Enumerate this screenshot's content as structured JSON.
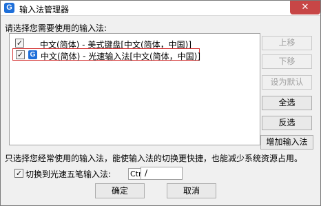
{
  "window": {
    "title": "输入法管理器",
    "app_icon_glyph": "G",
    "close_glyph": "✕"
  },
  "list": {
    "label": "请选择您需要使用的输入法:",
    "items": [
      {
        "label": "中文(简体) - 美式键盘[中文(简体，中国)]",
        "checked": true,
        "has_icon": false
      },
      {
        "label": "中文(简体) - 光速输入法[中文(简体，中国)]",
        "checked": true,
        "has_icon": true,
        "icon_glyph": "G"
      }
    ]
  },
  "side_buttons": {
    "move_up": "上移",
    "move_down": "下移",
    "set_default": "设为默认",
    "select_all": "全选",
    "invert": "反选",
    "add_ime": "增加输入法"
  },
  "hint": "只选择您经常使用的输入法，能使输入法的切换更快捷，也能减少系统资源占用。",
  "switch": {
    "checked": true,
    "label": "切换到光速五笔输入法:",
    "hotkey": "Ctrl+",
    "key_value": "/"
  },
  "buttons": {
    "ok": "确定",
    "cancel": "取消"
  },
  "check_glyph": "✓"
}
